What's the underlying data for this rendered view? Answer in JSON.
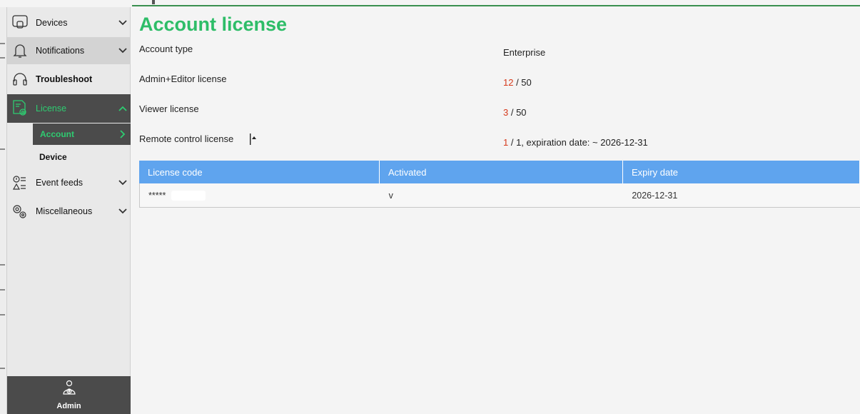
{
  "sidebar": {
    "items": [
      {
        "label": "Devices",
        "icon": "device-screen-icon"
      },
      {
        "label": "Notifications",
        "icon": "bell-icon"
      },
      {
        "label": "Troubleshoot",
        "icon": "headset-icon"
      },
      {
        "label": "License",
        "icon": "license-doc-icon"
      },
      {
        "label": "Event feeds",
        "icon": "event-feeds-icon"
      },
      {
        "label": "Miscellaneous",
        "icon": "gears-icon"
      }
    ],
    "license_sub": [
      {
        "label": "Account"
      },
      {
        "label": "Device"
      }
    ],
    "admin_label": "Admin"
  },
  "main": {
    "title": "Account license",
    "account_type_label": "Account type",
    "account_type_value": "Enterprise",
    "admin_editor_label": "Admin+Editor license",
    "admin_editor_used": "12",
    "admin_editor_total": " / 50",
    "viewer_label": "Viewer license",
    "viewer_used": "3",
    "viewer_total": " / 50",
    "remote_label": "Remote control license",
    "remote_used": "1",
    "remote_rest": " / 1, expiration date: ~ 2026-12-31"
  },
  "table": {
    "headers": [
      "License code",
      "Activated",
      "Expiry date"
    ],
    "rows": [
      {
        "code": "*****",
        "activated": "v",
        "expiry": "2026-12-31"
      }
    ]
  },
  "colors": {
    "accent_green": "#2ebd68",
    "sidebar_active": "#4b4b4b",
    "table_header": "#5fa4ee",
    "used_red": "#d63a1c"
  }
}
